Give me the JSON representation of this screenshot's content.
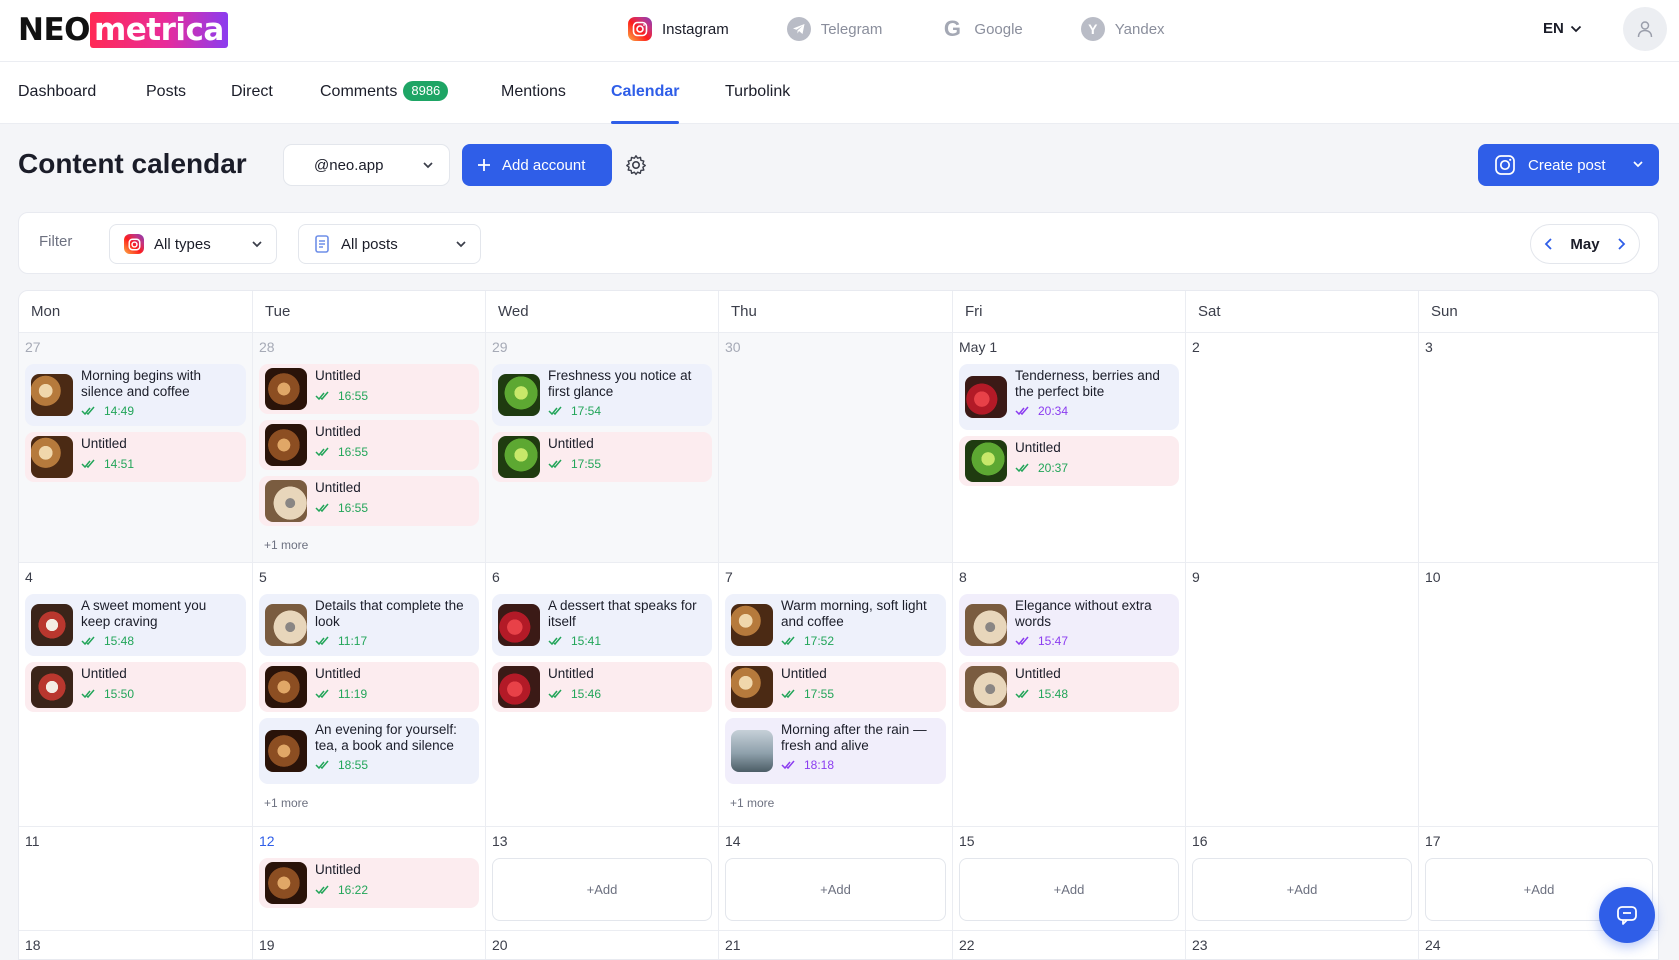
{
  "brand": {
    "logo_left": "NEO",
    "logo_right": "metrica"
  },
  "networks": [
    {
      "name": "Instagram",
      "icon": "instagram-icon",
      "active": true
    },
    {
      "name": "Telegram",
      "icon": "telegram-icon",
      "active": false
    },
    {
      "name": "Google",
      "icon": "google-icon",
      "active": false
    },
    {
      "name": "Yandex",
      "icon": "yandex-icon",
      "active": false
    }
  ],
  "language": "EN",
  "nav": {
    "dashboard": "Dashboard",
    "posts": "Posts",
    "direct": "Direct",
    "comments": "Comments",
    "comments_badge": "8986",
    "mentions": "Mentions",
    "calendar": "Calendar",
    "turbolink": "Turbolink"
  },
  "page": {
    "title": "Content calendar",
    "account": "@neo.app",
    "add_account": "Add account",
    "create_post": "Create post"
  },
  "filter": {
    "label": "Filter",
    "types": "All types",
    "posts": "All posts",
    "month": "May"
  },
  "colors": {
    "accent": "#2f5ee8",
    "success": "#22a559",
    "scheduled": "#8b3cf0",
    "badge": "#1ea565"
  },
  "weekdays": [
    "Mon",
    "Tue",
    "Wed",
    "Thu",
    "Fri",
    "Sat",
    "Sun"
  ],
  "weeks": [
    [
      {
        "day": "27",
        "dim": true,
        "posts": [
          {
            "title": "Morning begins with silence and coffee",
            "time": "14:49",
            "thumb": "coffee",
            "tone": "blue",
            "status": "green"
          },
          {
            "title": "Untitled",
            "time": "14:51",
            "thumb": "coffee",
            "tone": "pink",
            "status": "green"
          }
        ]
      },
      {
        "day": "28",
        "dim": true,
        "more": "+1 more",
        "posts": [
          {
            "title": "Untitled",
            "time": "16:55",
            "thumb": "choc",
            "tone": "pink",
            "status": "green"
          },
          {
            "title": "Untitled",
            "time": "16:55",
            "thumb": "choc",
            "tone": "pink",
            "status": "green"
          },
          {
            "title": "Untitled",
            "time": "16:55",
            "thumb": "camera",
            "tone": "pink",
            "status": "green"
          }
        ]
      },
      {
        "day": "29",
        "dim": true,
        "posts": [
          {
            "title": "Freshness you notice at first glance",
            "time": "17:54",
            "thumb": "leaf",
            "tone": "blue",
            "status": "green"
          },
          {
            "title": "Untitled",
            "time": "17:55",
            "thumb": "leaf",
            "tone": "pink",
            "status": "green"
          }
        ]
      },
      {
        "day": "30",
        "dim": true,
        "posts": []
      },
      {
        "day": "May 1",
        "posts": [
          {
            "title": "Tenderness, berries and the perfect bite",
            "time": "20:34",
            "thumb": "berry",
            "tone": "blue",
            "status": "purple"
          },
          {
            "title": "Untitled",
            "time": "20:37",
            "thumb": "leaf",
            "tone": "pink",
            "status": "green"
          }
        ]
      },
      {
        "day": "2",
        "posts": []
      },
      {
        "day": "3",
        "posts": []
      }
    ],
    [
      {
        "day": "4",
        "posts": [
          {
            "title": "A sweet moment you keep craving",
            "time": "15:48",
            "thumb": "cake",
            "tone": "blue",
            "status": "green"
          },
          {
            "title": "Untitled",
            "time": "15:50",
            "thumb": "cake",
            "tone": "pink",
            "status": "green"
          }
        ]
      },
      {
        "day": "5",
        "more": "+1 more",
        "posts": [
          {
            "title": "Details that complete the look",
            "time": "11:17",
            "thumb": "camera",
            "tone": "blue",
            "status": "green"
          },
          {
            "title": "Untitled",
            "time": "11:19",
            "thumb": "choc",
            "tone": "pink",
            "status": "green"
          },
          {
            "title": "An evening for yourself: tea, a book and silence",
            "time": "18:55",
            "thumb": "choc",
            "tone": "blue",
            "status": "green"
          }
        ]
      },
      {
        "day": "6",
        "posts": [
          {
            "title": "A dessert that speaks for itself",
            "time": "15:41",
            "thumb": "berry",
            "tone": "blue",
            "status": "green"
          },
          {
            "title": "Untitled",
            "time": "15:46",
            "thumb": "berry",
            "tone": "pink",
            "status": "green"
          }
        ]
      },
      {
        "day": "7",
        "more": "+1 more",
        "posts": [
          {
            "title": "Warm morning, soft light and coffee",
            "time": "17:52",
            "thumb": "coffee",
            "tone": "blue",
            "status": "green"
          },
          {
            "title": "Untitled",
            "time": "17:55",
            "thumb": "coffee",
            "tone": "pink",
            "status": "green"
          },
          {
            "title": "Morning after the rain — fresh and alive",
            "time": "18:18",
            "thumb": "rain",
            "tone": "lav",
            "status": "purple"
          }
        ]
      },
      {
        "day": "8",
        "posts": [
          {
            "title": "Elegance without extra words",
            "time": "15:47",
            "thumb": "camera",
            "tone": "lav",
            "status": "purple"
          },
          {
            "title": "Untitled",
            "time": "15:48",
            "thumb": "camera",
            "tone": "pink",
            "status": "green"
          }
        ]
      },
      {
        "day": "9",
        "posts": []
      },
      {
        "day": "10",
        "posts": []
      }
    ],
    [
      {
        "day": "11",
        "posts": []
      },
      {
        "day": "12",
        "today": true,
        "posts": [
          {
            "title": "Untitled",
            "time": "16:22",
            "thumb": "choc",
            "tone": "pink",
            "status": "green"
          }
        ]
      },
      {
        "day": "13",
        "add": "+Add",
        "posts": []
      },
      {
        "day": "14",
        "add": "+Add",
        "posts": []
      },
      {
        "day": "15",
        "add": "+Add",
        "posts": []
      },
      {
        "day": "16",
        "add": "+Add",
        "posts": []
      },
      {
        "day": "17",
        "add": "+Add",
        "posts": []
      }
    ],
    [
      {
        "day": "18",
        "posts": []
      },
      {
        "day": "19",
        "posts": []
      },
      {
        "day": "20",
        "posts": []
      },
      {
        "day": "21",
        "posts": []
      },
      {
        "day": "22",
        "posts": []
      },
      {
        "day": "23",
        "posts": []
      },
      {
        "day": "24",
        "posts": []
      }
    ]
  ]
}
